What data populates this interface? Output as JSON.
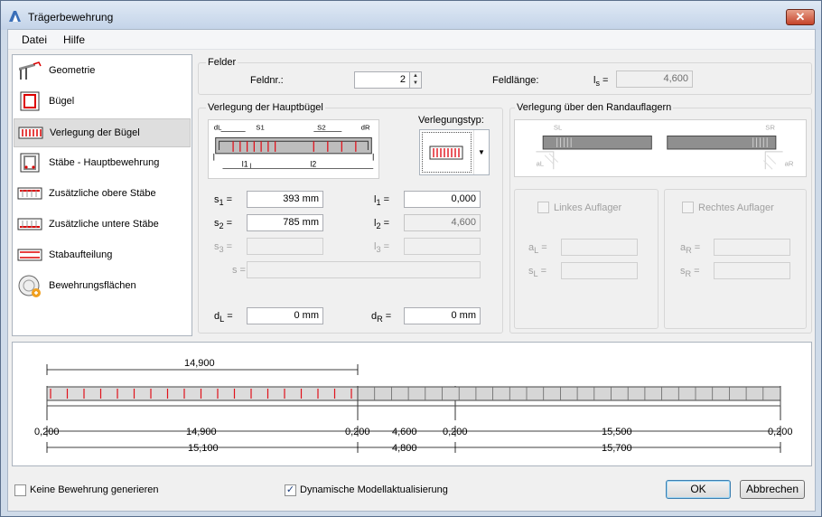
{
  "window": {
    "title": "Trägerbewehrung",
    "close": "✕"
  },
  "menu": [
    "Datei",
    "Hilfe"
  ],
  "nav": [
    {
      "label": "Geometrie",
      "icon": "geometry-icon"
    },
    {
      "label": "Bügel",
      "icon": "stirrup-icon"
    },
    {
      "label": "Verlegung der Bügel",
      "icon": "stirrup-placement-icon"
    },
    {
      "label": "Stäbe - Hauptbewehrung",
      "icon": "main-bars-icon"
    },
    {
      "label": "Zusätzliche obere Stäbe",
      "icon": "top-bars-icon"
    },
    {
      "label": "Zusätzliche untere Stäbe",
      "icon": "bottom-bars-icon"
    },
    {
      "label": "Stabaufteilung",
      "icon": "bar-distribution-icon"
    },
    {
      "label": "Bewehrungsflächen",
      "icon": "reinforcement-areas-icon"
    }
  ],
  "felder": {
    "title": "Felder",
    "feldnr_label": "Feldnr.:",
    "feldnr_value": "2",
    "feldlaenge_label": "Feldlänge:",
    "ls_label": "l",
    "ls_sub": "s",
    "eq": "=",
    "ls_value": "4,600"
  },
  "haupt": {
    "title": "Verlegung der Hauptbügel",
    "type_label": "Verlegungstyp:",
    "diagram": {
      "dl": "dL",
      "s1": "S1",
      "s2": "S2",
      "dr": "dR",
      "l1": "l1",
      "l2": "l2"
    },
    "s1": {
      "label": "s",
      "sub": "1",
      "value": "393",
      "unit": "mm"
    },
    "s2": {
      "label": "s",
      "sub": "2",
      "value": "785",
      "unit": "mm"
    },
    "s3": {
      "label": "s",
      "sub": "3"
    },
    "s": {
      "label": "s"
    },
    "l1": {
      "label": "l",
      "sub": "1",
      "value": "0,000"
    },
    "l2": {
      "label": "l",
      "sub": "2",
      "value": "4,600"
    },
    "l3": {
      "label": "l",
      "sub": "3"
    },
    "dl": {
      "label": "d",
      "sub": "L",
      "value": "0",
      "unit": "mm"
    },
    "dr": {
      "label": "d",
      "sub": "R",
      "value": "0",
      "unit": "mm"
    }
  },
  "rand": {
    "title": "Verlegung über den Randauflagern",
    "diagram": {
      "sl": "SL",
      "sr": "SR",
      "al": "aL",
      "ar": "aR"
    },
    "left": {
      "label": "Linkes Auflager",
      "a": "a",
      "a_sub": "L",
      "s": "s",
      "s_sub": "L"
    },
    "right": {
      "label": "Rechtes Auflager",
      "a": "a",
      "a_sub": "R",
      "s": "s",
      "s_sub": "R"
    }
  },
  "preview": {
    "top_dim": "14,900",
    "row1": [
      "0,200",
      "14,900",
      "0,200",
      "4,600",
      "0,200",
      "15,500",
      "0,200"
    ],
    "row2": [
      "15,100",
      "4,800",
      "15,700"
    ]
  },
  "footer": {
    "keine": "Keine Bewehrung generieren",
    "dyn": "Dynamische Modellaktualisierung",
    "ok": "OK",
    "cancel": "Abbrechen"
  },
  "colors": {
    "accent_red": "#e0111b",
    "title_gradient_top": "#dfe9f5",
    "beam_grey": "#8f8f8f"
  }
}
